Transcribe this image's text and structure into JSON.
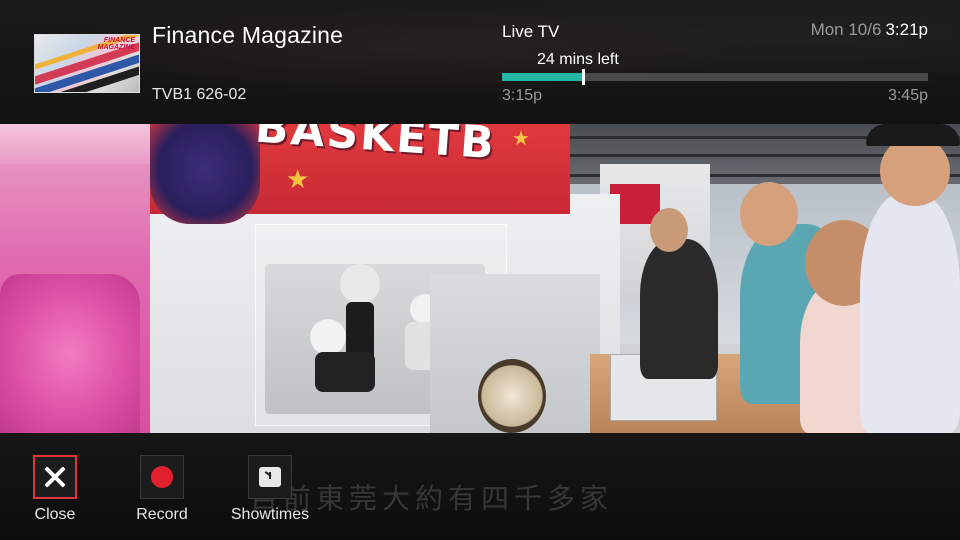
{
  "header": {
    "program_title": "Finance Magazine",
    "channel": "TVB1 626-02",
    "thumbnail_text": "FINANCE MAGAZINE",
    "live_label": "Live TV",
    "remaining": "24 mins left",
    "progress_fraction": 0.19,
    "start_time": "3:15p",
    "end_time": "3:45p",
    "date": "Mon 10/6",
    "current_time": "3:21p"
  },
  "video": {
    "banner_text": "BASKETB",
    "subtitle": "目前東莞大約有四千多家"
  },
  "actions": [
    {
      "label": "Close",
      "icon": "close-icon",
      "focused": true
    },
    {
      "label": "Record",
      "icon": "record-icon",
      "focused": false
    },
    {
      "label": "Showtimes",
      "icon": "clock-icon",
      "focused": false
    }
  ],
  "colors": {
    "progress_fill": "#23b7a5",
    "progress_track": "#4a4a4a",
    "focus_border": "#e0343c",
    "record_red": "#e3202f"
  }
}
